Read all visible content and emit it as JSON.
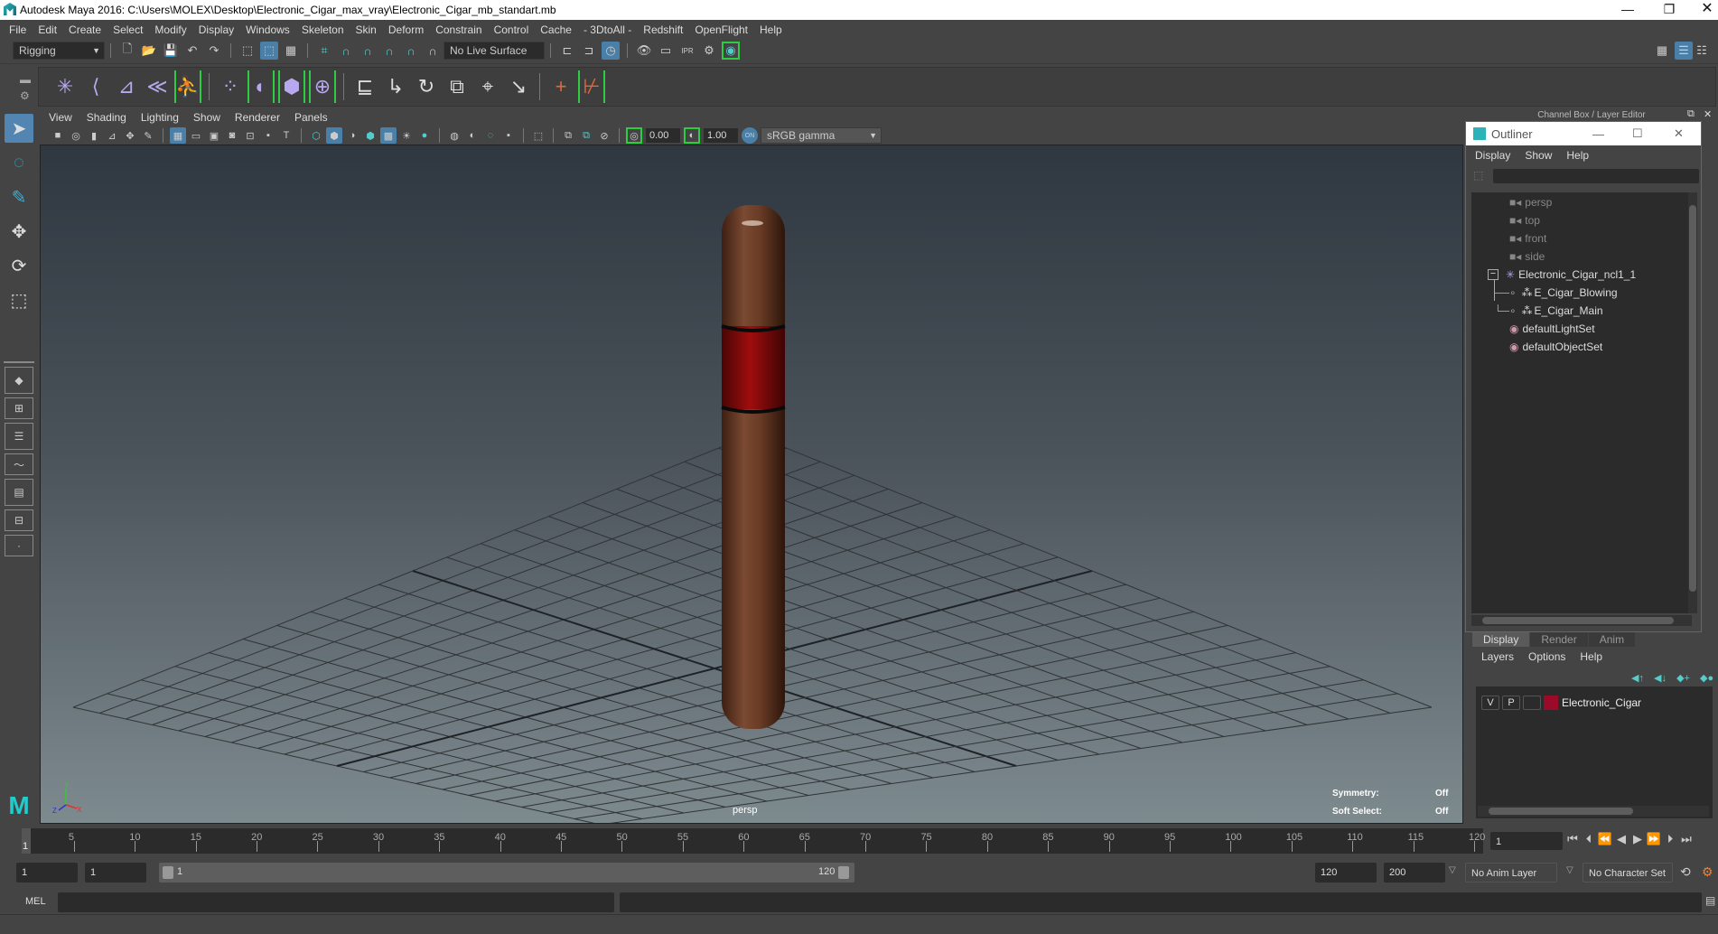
{
  "window": {
    "title": "Autodesk Maya 2016: C:\\Users\\MOLEX\\Desktop\\Electronic_Cigar_max_vray\\Electronic_Cigar_mb_standart.mb",
    "controls": {
      "minimize": "—",
      "restore": "❐",
      "close": "✕"
    }
  },
  "menubar": [
    "File",
    "Edit",
    "Create",
    "Select",
    "Modify",
    "Display",
    "Windows",
    "Skeleton",
    "Skin",
    "Deform",
    "Constrain",
    "Control",
    "Cache",
    "- 3DtoAll -",
    "Redshift",
    "OpenFlight",
    "Help"
  ],
  "statusline": {
    "menuset": "Rigging",
    "live_surface": "No Live Surface"
  },
  "shelf": {
    "icons": [
      "joint-tool",
      "ik-handle",
      "ik-spline",
      "insert-joint",
      "hik-character",
      "paint-weights",
      "bind-skin",
      "lattice",
      "cluster",
      "parent-constraint",
      "point-constraint",
      "orient-constraint",
      "scale-constraint",
      "aim-constraint",
      "pole-vector",
      "add-influence",
      "remove-influence"
    ]
  },
  "viewport": {
    "menu": [
      "View",
      "Shading",
      "Lighting",
      "Show",
      "Renderer",
      "Panels"
    ],
    "exposure": "0.00",
    "gamma": "1.00",
    "color_management": "sRGB gamma",
    "camera_label": "persp",
    "hud": {
      "symmetry_label": "Symmetry:",
      "symmetry_value": "Off",
      "soft_select_label": "Soft Select:",
      "soft_select_value": "Off"
    },
    "axes": {
      "x": "X",
      "y": "Y",
      "z": "Z"
    },
    "colors": {
      "cigar_body": "#6b3a24",
      "cigar_band": "#9b0d0d",
      "grid": "#2f3336"
    }
  },
  "channel_box_header": "Channel Box / Layer Editor",
  "outliner": {
    "title": "Outliner",
    "menu": [
      "Display",
      "Show",
      "Help"
    ],
    "items": [
      {
        "label": "persp",
        "type": "camera",
        "dim": true
      },
      {
        "label": "top",
        "type": "camera",
        "dim": true
      },
      {
        "label": "front",
        "type": "camera",
        "dim": true
      },
      {
        "label": "side",
        "type": "camera",
        "dim": true
      },
      {
        "label": "Electronic_Cigar_ncl1_1",
        "type": "group",
        "expanded": true
      },
      {
        "label": "E_Cigar_Blowing",
        "type": "mesh",
        "child": true
      },
      {
        "label": "E_Cigar_Main",
        "type": "mesh",
        "child": true
      },
      {
        "label": "defaultLightSet",
        "type": "set"
      },
      {
        "label": "defaultObjectSet",
        "type": "set"
      }
    ]
  },
  "layer_editor": {
    "tabs": [
      "Display",
      "Render",
      "Anim"
    ],
    "active_tab": "Display",
    "menu": [
      "Layers",
      "Options",
      "Help"
    ],
    "layers": [
      {
        "v": "V",
        "p": "P",
        "name": "Electronic_Cigar",
        "color": "#9b0a26"
      }
    ]
  },
  "timeline": {
    "ticks": [
      "5",
      "10",
      "15",
      "20",
      "25",
      "30",
      "35",
      "40",
      "45",
      "50",
      "55",
      "60",
      "65",
      "70",
      "75",
      "80",
      "85",
      "90",
      "95",
      "100",
      "105",
      "110",
      "115",
      "120"
    ],
    "current_frame_marker": "1",
    "current_frame": "1",
    "range_min": 1,
    "range_max": 120
  },
  "range": {
    "start": "1",
    "playback_start": "1",
    "slider_start": "1",
    "slider_end": "120",
    "playback_end": "120",
    "end": "200",
    "anim_layer": "No Anim Layer",
    "character_set": "No Character Set"
  },
  "command_line": {
    "label": "MEL",
    "value": ""
  }
}
